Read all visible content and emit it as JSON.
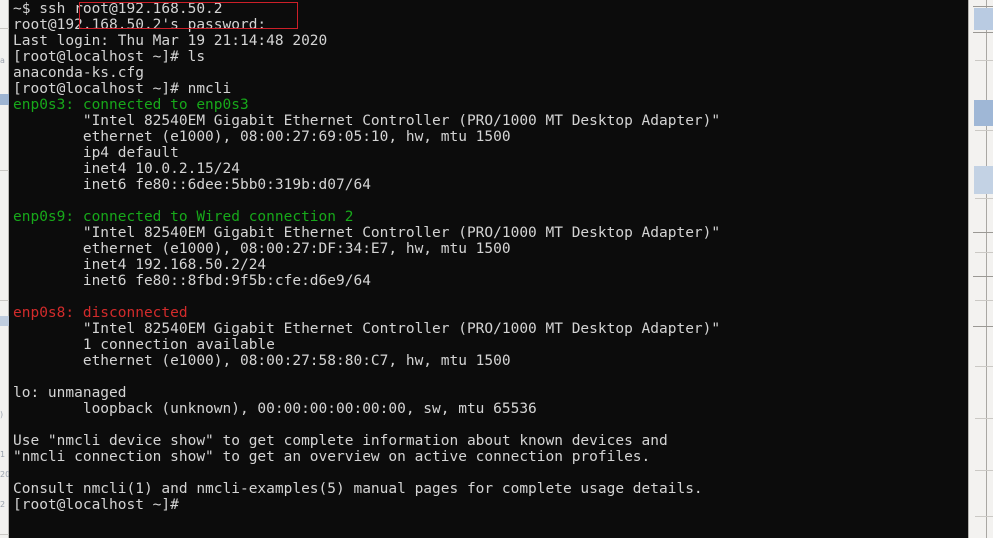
{
  "terminal": {
    "title": "ssh session",
    "colors": {
      "background": "#0c0c0c",
      "foreground": "#d4d4d4",
      "green": "#17a81a",
      "red": "#d22b2b",
      "annotation": "#cc1f28"
    },
    "lines": [
      {
        "id": "l01",
        "indent": "",
        "text": "~$ ssh root@192.168.50.2",
        "color": "white"
      },
      {
        "id": "l02",
        "indent": "",
        "text": "root@192.168.50.2's password:",
        "color": "white"
      },
      {
        "id": "l03",
        "indent": "",
        "text": "Last login: Thu Mar 19 21:14:48 2020",
        "color": "white"
      },
      {
        "id": "l04",
        "indent": "",
        "text": "[root@localhost ~]# ls",
        "color": "white"
      },
      {
        "id": "l05",
        "indent": "",
        "text": "anaconda-ks.cfg",
        "color": "white"
      },
      {
        "id": "l06",
        "indent": "",
        "text": "[root@localhost ~]# nmcli",
        "color": "white"
      },
      {
        "id": "l07",
        "indent": "",
        "text": "enp0s3: connected to enp0s3",
        "color": "green"
      },
      {
        "id": "l08",
        "indent": "        ",
        "text": "\"Intel 82540EM Gigabit Ethernet Controller (PRO/1000 MT Desktop Adapter)\"",
        "color": "white"
      },
      {
        "id": "l09",
        "indent": "        ",
        "text": "ethernet (e1000), 08:00:27:69:05:10, hw, mtu 1500",
        "color": "white"
      },
      {
        "id": "l10",
        "indent": "        ",
        "text": "ip4 default",
        "color": "white"
      },
      {
        "id": "l11",
        "indent": "        ",
        "text": "inet4 10.0.2.15/24",
        "color": "white"
      },
      {
        "id": "l12",
        "indent": "        ",
        "text": "inet6 fe80::6dee:5bb0:319b:d07/64",
        "color": "white"
      },
      {
        "id": "l13",
        "indent": "",
        "text": "",
        "color": "white"
      },
      {
        "id": "l14",
        "indent": "",
        "text": "enp0s9: connected to Wired connection 2",
        "color": "green"
      },
      {
        "id": "l15",
        "indent": "        ",
        "text": "\"Intel 82540EM Gigabit Ethernet Controller (PRO/1000 MT Desktop Adapter)\"",
        "color": "white"
      },
      {
        "id": "l16",
        "indent": "        ",
        "text": "ethernet (e1000), 08:00:27:DF:34:E7, hw, mtu 1500",
        "color": "white"
      },
      {
        "id": "l17",
        "indent": "        ",
        "text": "inet4 192.168.50.2/24",
        "color": "white"
      },
      {
        "id": "l18",
        "indent": "        ",
        "text": "inet6 fe80::8fbd:9f5b:cfe:d6e9/64",
        "color": "white"
      },
      {
        "id": "l19",
        "indent": "",
        "text": "",
        "color": "white"
      },
      {
        "id": "l20",
        "indent": "",
        "text": "enp0s8: disconnected",
        "color": "red"
      },
      {
        "id": "l21",
        "indent": "        ",
        "text": "\"Intel 82540EM Gigabit Ethernet Controller (PRO/1000 MT Desktop Adapter)\"",
        "color": "white"
      },
      {
        "id": "l22",
        "indent": "        ",
        "text": "1 connection available",
        "color": "white"
      },
      {
        "id": "l23",
        "indent": "        ",
        "text": "ethernet (e1000), 08:00:27:58:80:C7, hw, mtu 1500",
        "color": "white"
      },
      {
        "id": "l24",
        "indent": "",
        "text": "",
        "color": "white"
      },
      {
        "id": "l25",
        "indent": "",
        "text": "lo: unmanaged",
        "color": "white"
      },
      {
        "id": "l26",
        "indent": "        ",
        "text": "loopback (unknown), 00:00:00:00:00:00, sw, mtu 65536",
        "color": "white"
      },
      {
        "id": "l27",
        "indent": "",
        "text": "",
        "color": "white"
      },
      {
        "id": "l28",
        "indent": "",
        "text": "Use \"nmcli device show\" to get complete information about known devices and",
        "color": "white"
      },
      {
        "id": "l29",
        "indent": "",
        "text": "\"nmcli connection show\" to get an overview on active connection profiles.",
        "color": "white"
      },
      {
        "id": "l30",
        "indent": "",
        "text": "",
        "color": "white"
      },
      {
        "id": "l31",
        "indent": "",
        "text": "Consult nmcli(1) and nmcli-examples(5) manual pages for complete usage details.",
        "color": "white"
      },
      {
        "id": "l32",
        "indent": "",
        "text": "[root@localhost ~]#",
        "color": "white"
      }
    ],
    "colored_lines": {
      "l07": {
        "device": "enp0s3:",
        "status": " connected to enp0s3",
        "device_color": "green",
        "status_color": "green"
      },
      "l14": {
        "device": "enp0s9:",
        "status": " connected to Wired connection 2",
        "device_color": "green",
        "status_color": "green"
      },
      "l20": {
        "device": "enp0s8:",
        "status": " disconnected",
        "device_color": "red",
        "status_color": "red"
      }
    },
    "annotation": {
      "name": "ssh-command-highlight",
      "shape": "rectangle",
      "color": "#cc1f28",
      "target_text": "~$ ssh root@192.168.50.2"
    }
  },
  "background": {
    "left_strip_rows": [
      "",
      "",
      "2",
      "",
      "",
      "",
      "",
      "",
      "",
      "",
      "",
      "",
      "1",
      "",
      "20",
      "2"
    ],
    "right_pane_visible": true
  }
}
